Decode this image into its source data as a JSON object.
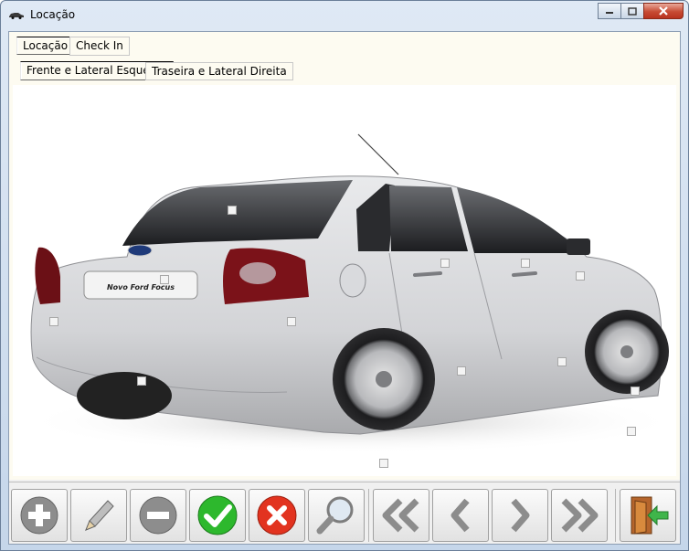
{
  "window": {
    "title": "Locação",
    "icon": "car-icon",
    "controls": [
      "minimize-icon",
      "maximize-icon",
      "close-icon"
    ]
  },
  "tabs": {
    "main": [
      {
        "label": "Locação",
        "selected": false
      },
      {
        "label": "Check In",
        "selected": true
      }
    ],
    "views": [
      {
        "label": "Frente e Lateral Esquerda",
        "selected": false
      },
      {
        "label": "Traseira e Lateral Direita",
        "selected": true
      }
    ]
  },
  "vehicle": {
    "model_badge": "Novo Ford Focus",
    "brand": "Ford",
    "body_color": "#d9dadd",
    "damage_marker_count": 13
  },
  "toolbar": {
    "buttons": [
      {
        "name": "add-button",
        "icon": "plus-icon"
      },
      {
        "name": "edit-button",
        "icon": "pencil-icon"
      },
      {
        "name": "remove-button",
        "icon": "minus-icon"
      },
      {
        "name": "confirm-button",
        "icon": "check-icon"
      },
      {
        "name": "cancel-button",
        "icon": "x-icon"
      },
      {
        "name": "search-button",
        "icon": "magnifier-icon"
      },
      {
        "name": "first-record-button",
        "icon": "double-chevron-left-icon"
      },
      {
        "name": "previous-record-button",
        "icon": "chevron-left-icon"
      },
      {
        "name": "next-record-button",
        "icon": "chevron-right-icon"
      },
      {
        "name": "last-record-button",
        "icon": "double-chevron-right-icon"
      },
      {
        "name": "exit-button",
        "icon": "exit-door-icon"
      }
    ]
  },
  "colors": {
    "confirm": "#2db82d",
    "cancel": "#e2331f",
    "exit_arrow": "#3fb54a",
    "tab_panel": "#fdfbf1"
  }
}
